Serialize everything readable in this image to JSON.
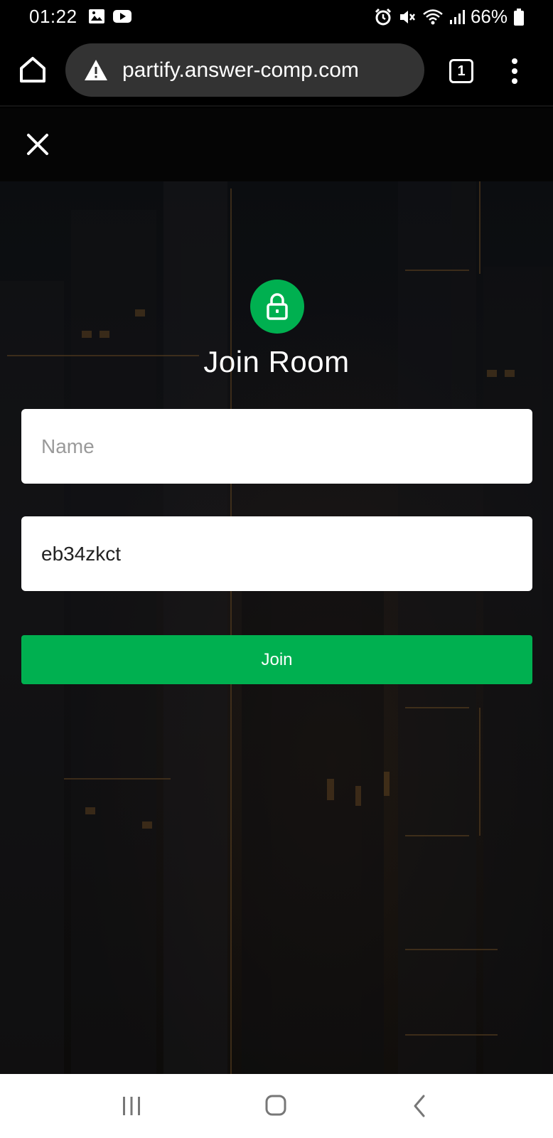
{
  "status_bar": {
    "time": "01:22",
    "battery": "66%",
    "left_icons": [
      "image-icon",
      "youtube-icon"
    ],
    "right_icons": [
      "alarm-icon",
      "mute-icon",
      "wifi-icon",
      "signal-icon",
      "battery-icon"
    ]
  },
  "browser": {
    "url": "partify.answer-comp.com",
    "tab_count": "1",
    "icons": [
      "home-icon",
      "warning-icon",
      "tabs-icon",
      "more-vert-icon"
    ]
  },
  "page": {
    "title": "Join Room",
    "name_field": {
      "placeholder": "Name",
      "value": ""
    },
    "code_field": {
      "placeholder": "",
      "value": "eb34zkct"
    },
    "join_button": "Join",
    "accent_color": "#00b050",
    "icons": [
      "close-icon",
      "lock-icon"
    ]
  },
  "nav_bar": {
    "icons": [
      "recent-apps-icon",
      "home-icon",
      "back-icon"
    ]
  }
}
